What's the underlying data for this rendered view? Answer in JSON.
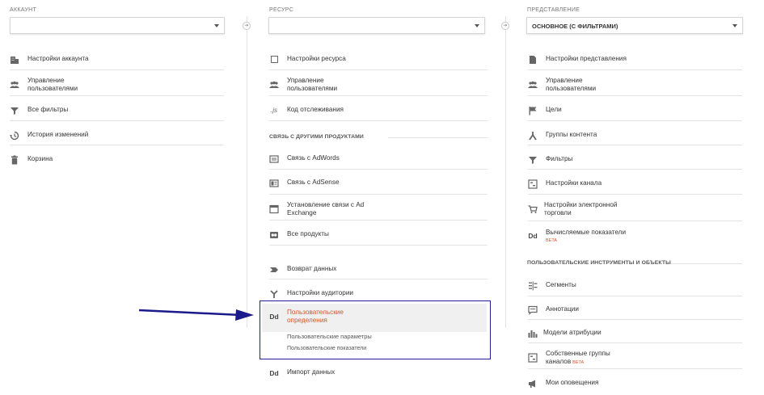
{
  "account": {
    "label": "АККАУНТ",
    "items": [
      {
        "icon": "building-icon",
        "label": "Настройки аккаунта"
      },
      {
        "icon": "people-icon",
        "label": "Управление",
        "label2": "пользователями"
      },
      {
        "icon": "filter-icon",
        "label": "Все фильтры"
      },
      {
        "icon": "history-icon",
        "label": "История изменений"
      },
      {
        "icon": "trash-icon",
        "label": "Корзина"
      }
    ]
  },
  "resource": {
    "label": "РЕСУРС",
    "items_top": [
      {
        "icon": "square-icon",
        "label": "Настройки ресурса"
      },
      {
        "icon": "people-icon",
        "label": "Управление",
        "label2": "пользователями"
      },
      {
        "icon": "js-icon",
        "label": "Код отслеживания"
      }
    ],
    "section": "СВЯЗЬ С ДРУГИМИ ПРОДУКТАМИ",
    "items_link": [
      {
        "icon": "adwords-icon",
        "label": "Связь с AdWords"
      },
      {
        "icon": "adsense-icon",
        "label": "Связь с AdSense"
      },
      {
        "icon": "exchange-icon",
        "label": "Установление связи с Ad",
        "label2": "Exchange"
      },
      {
        "icon": "products-icon",
        "label": "Все продукты"
      }
    ],
    "items_bottom": [
      {
        "icon": "data-return-icon",
        "label": "Возврат данных"
      },
      {
        "icon": "audience-icon",
        "label": "Настройки аудитории"
      }
    ],
    "custom": {
      "icon": "Dd",
      "label": "Пользовательские",
      "label2": "определения",
      "sub1": "Пользовательские параметры",
      "sub2": "Пользовательские показатели"
    },
    "import": {
      "icon": "Dd",
      "label": "Импорт данных"
    }
  },
  "view": {
    "label": "ПРЕДСТАВЛЕНИЕ",
    "selected": "ОСНОВНОЕ (С ФИЛЬТРАМИ)",
    "items": [
      {
        "icon": "document-icon",
        "label": "Настройки представления"
      },
      {
        "icon": "people-icon",
        "label": "Управление",
        "label2": "пользователями"
      },
      {
        "icon": "flag-icon",
        "label": "Цели"
      },
      {
        "icon": "content-groups-icon",
        "label": "Группы контента"
      },
      {
        "icon": "filter-icon",
        "label": "Фильтры"
      },
      {
        "icon": "channel-icon",
        "label": "Настройки канала"
      },
      {
        "icon": "cart-icon",
        "label": "Настройки электронной",
        "label2": "торговли"
      },
      {
        "icon": "Dd",
        "label": "Вычисляемые показатели",
        "badge": "BETA"
      }
    ],
    "section": "ПОЛЬЗОВАТЕЛЬСКИЕ ИНСТРУМЕНТЫ И ОБЪЕКТЫ",
    "tools": [
      {
        "icon": "segments-icon",
        "label": "Сегменты"
      },
      {
        "icon": "annotation-icon",
        "label": "Аннотации"
      },
      {
        "icon": "attribution-icon",
        "label": "Модели атрибуции"
      },
      {
        "icon": "channel-groups-icon",
        "label": "Собственные группы",
        "label2": "каналов",
        "badge": "BETA"
      },
      {
        "icon": "megaphone-icon",
        "label": "Мои оповещения"
      }
    ]
  },
  "colors": {
    "accent_red": "#d9532c",
    "highlight_border": "#22219a",
    "arrow": "#1a1a8c"
  }
}
